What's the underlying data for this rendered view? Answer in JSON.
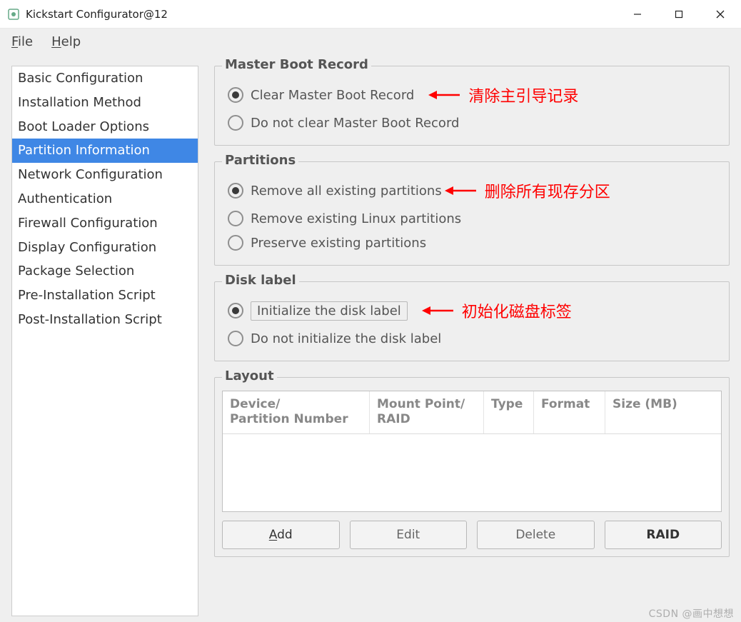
{
  "window": {
    "title": "Kickstart Configurator@12"
  },
  "menubar": {
    "file": "File",
    "help": "Help"
  },
  "sidebar": {
    "items": [
      "Basic Configuration",
      "Installation Method",
      "Boot Loader Options",
      "Partition Information",
      "Network Configuration",
      "Authentication",
      "Firewall Configuration",
      "Display Configuration",
      "Package Selection",
      "Pre-Installation Script",
      "Post-Installation Script"
    ],
    "selected_index": 3
  },
  "groups": {
    "mbr": {
      "legend": "Master Boot Record",
      "options": [
        "Clear Master Boot Record",
        "Do not clear Master Boot Record"
      ],
      "selected": 0,
      "annotation": "清除主引导记录"
    },
    "partitions": {
      "legend": "Partitions",
      "options": [
        "Remove all existing partitions",
        "Remove existing Linux partitions",
        "Preserve existing partitions"
      ],
      "selected": 0,
      "annotation": "删除所有现存分区"
    },
    "disklabel": {
      "legend": "Disk label",
      "options": [
        "Initialize the disk label",
        "Do not initialize the disk label"
      ],
      "selected": 0,
      "annotation": "初始化磁盘标签"
    },
    "layout": {
      "legend": "Layout",
      "columns": [
        "Device/\nPartition Number",
        "Mount Point/\nRAID",
        "Type",
        "Format",
        "Size (MB)"
      ],
      "rows": []
    }
  },
  "buttons": {
    "add": "Add",
    "edit": "Edit",
    "delete": "Delete",
    "raid": "RAID"
  },
  "watermark": "CSDN @画中想想"
}
